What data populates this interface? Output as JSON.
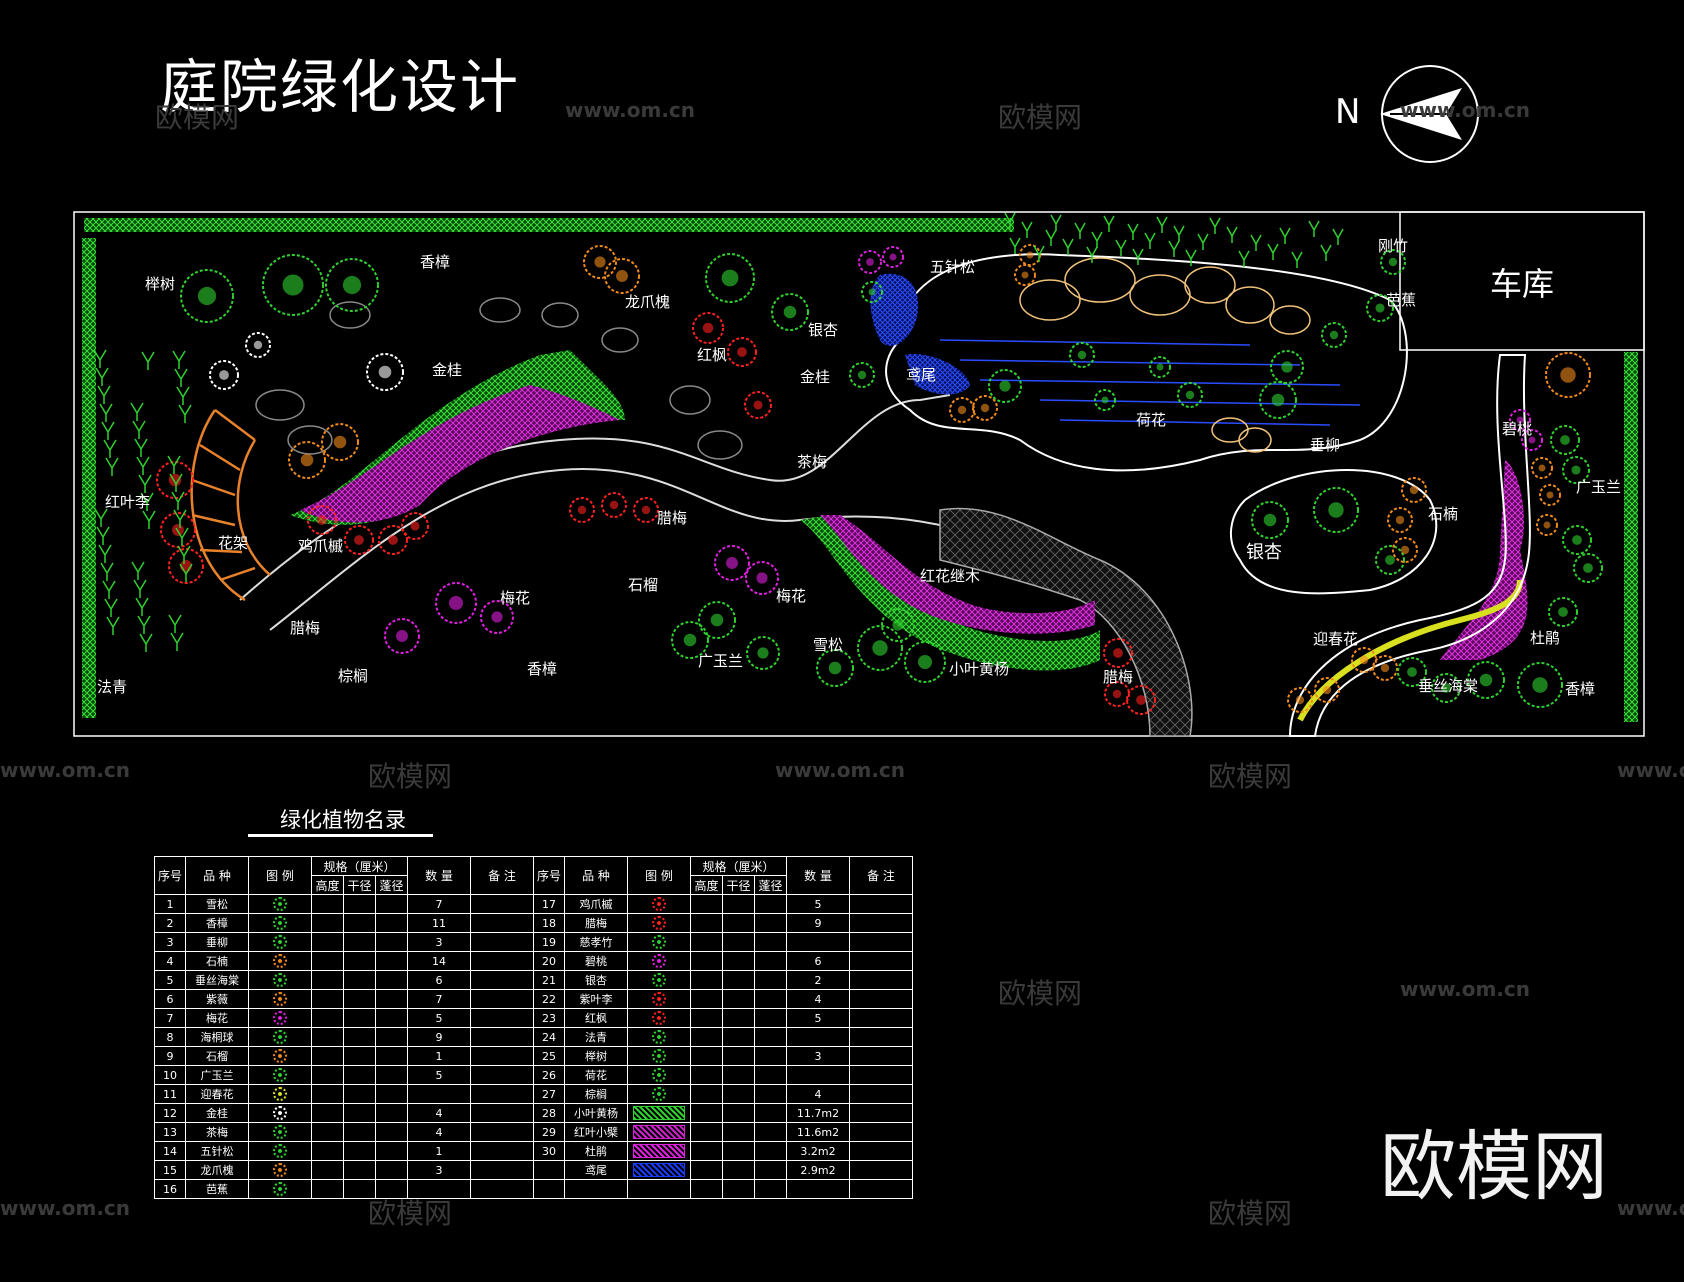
{
  "title": "庭院绿化设计",
  "north_label": "N",
  "garage_label": "车库",
  "brand": "欧模网",
  "watermarks": {
    "cn": "欧模网",
    "url": "www.om.cn"
  },
  "plan_labels": [
    {
      "id": "lbl-ju-shu",
      "text": "榉树"
    },
    {
      "id": "lbl-xiang-zhang-1",
      "text": "香樟"
    },
    {
      "id": "lbl-long-zhao-huai",
      "text": "龙爪槐"
    },
    {
      "id": "lbl-wu-zhen-song",
      "text": "五针松"
    },
    {
      "id": "lbl-gang-zhu",
      "text": "刚竹"
    },
    {
      "id": "lbl-ba-jiao",
      "text": "芭蕉"
    },
    {
      "id": "lbl-jin-gui-1",
      "text": "金桂"
    },
    {
      "id": "lbl-hong-feng",
      "text": "红枫"
    },
    {
      "id": "lbl-yin-xing-1",
      "text": "银杏"
    },
    {
      "id": "lbl-jin-gui-2",
      "text": "金桂"
    },
    {
      "id": "lbl-yuan-wei",
      "text": "鸢尾"
    },
    {
      "id": "lbl-he-hua",
      "text": "荷花"
    },
    {
      "id": "lbl-chui-liu",
      "text": "垂柳"
    },
    {
      "id": "lbl-bi-tao",
      "text": "碧桃"
    },
    {
      "id": "lbl-guang-yu-lan-1",
      "text": "广玉兰"
    },
    {
      "id": "lbl-cha-mei",
      "text": "茶梅"
    },
    {
      "id": "lbl-hong-ye-li",
      "text": "红叶李"
    },
    {
      "id": "lbl-hua-jia",
      "text": "花架"
    },
    {
      "id": "lbl-ji-zhao-qi",
      "text": "鸡爪槭"
    },
    {
      "id": "lbl-la-mei-1",
      "text": "腊梅"
    },
    {
      "id": "lbl-shi-liu",
      "text": "石榴"
    },
    {
      "id": "lbl-mei-hua-1",
      "text": "梅花"
    },
    {
      "id": "lbl-mei-hua-2",
      "text": "梅花"
    },
    {
      "id": "lbl-hong-hua-ji-mu",
      "text": "红花继木"
    },
    {
      "id": "lbl-shi-nan",
      "text": "石楠"
    },
    {
      "id": "lbl-yin-xing-2",
      "text": "银杏"
    },
    {
      "id": "lbl-la-mei-2",
      "text": "腊梅"
    },
    {
      "id": "lbl-xue-song",
      "text": "雪松"
    },
    {
      "id": "lbl-zong-lv",
      "text": "棕榈"
    },
    {
      "id": "lbl-xiang-zhang-2",
      "text": "香樟"
    },
    {
      "id": "lbl-guang-yu-lan-2",
      "text": "广玉兰"
    },
    {
      "id": "lbl-xiao-ye-huang-yang",
      "text": "小叶黄杨"
    },
    {
      "id": "lbl-la-mei-3",
      "text": "腊梅"
    },
    {
      "id": "lbl-fa-qing",
      "text": "法青"
    },
    {
      "id": "lbl-ying-chun-hua",
      "text": "迎春花"
    },
    {
      "id": "lbl-chui-si-hai-tang",
      "text": "垂丝海棠"
    },
    {
      "id": "lbl-du-juan",
      "text": "杜鹃"
    },
    {
      "id": "lbl-xiang-zhang-3",
      "text": "香樟"
    }
  ],
  "legend": {
    "title": "绿化植物名录",
    "headers": {
      "no": "序号",
      "species": "品 种",
      "symbol": "图 例",
      "spec": "规格（厘米）",
      "height": "高度",
      "trunk": "干径",
      "crown": "蓬径",
      "qty": "数 量",
      "remark": "备 注"
    },
    "left_rows": [
      {
        "no": "1",
        "name": "雪松",
        "qty": "7",
        "color": "#2fd12f"
      },
      {
        "no": "2",
        "name": "香樟",
        "qty": "11",
        "color": "#2fd12f"
      },
      {
        "no": "3",
        "name": "垂柳",
        "qty": "3",
        "color": "#2fd12f"
      },
      {
        "no": "4",
        "name": "石楠",
        "qty": "14",
        "color": "#f08a1a"
      },
      {
        "no": "5",
        "name": "垂丝海棠",
        "qty": "6",
        "color": "#2fd12f"
      },
      {
        "no": "6",
        "name": "紫薇",
        "qty": "7",
        "color": "#f08a1a"
      },
      {
        "no": "7",
        "name": "梅花",
        "qty": "5",
        "color": "#e020e0"
      },
      {
        "no": "8",
        "name": "海桐球",
        "qty": "9",
        "color": "#2fd12f"
      },
      {
        "no": "9",
        "name": "石榴",
        "qty": "1",
        "color": "#f08a1a"
      },
      {
        "no": "10",
        "name": "广玉兰",
        "qty": "5",
        "color": "#2fd12f"
      },
      {
        "no": "11",
        "name": "迎春花",
        "qty": "",
        "color": "#d8e020"
      },
      {
        "no": "12",
        "name": "金桂",
        "qty": "4",
        "color": "#ffffff"
      },
      {
        "no": "13",
        "name": "茶梅",
        "qty": "4",
        "color": "#2fd12f"
      },
      {
        "no": "14",
        "name": "五针松",
        "qty": "1",
        "color": "#2fd12f"
      },
      {
        "no": "15",
        "name": "龙爪槐",
        "qty": "3",
        "color": "#f08a1a"
      },
      {
        "no": "16",
        "name": "芭蕉",
        "qty": "",
        "color": "#2fd12f"
      }
    ],
    "right_rows": [
      {
        "no": "17",
        "name": "鸡爪槭",
        "qty": "5",
        "color": "#ff2020",
        "kind": "circ"
      },
      {
        "no": "18",
        "name": "腊梅",
        "qty": "9",
        "color": "#ff2020",
        "kind": "circ"
      },
      {
        "no": "19",
        "name": "慈孝竹",
        "qty": "",
        "color": "#2fd12f",
        "kind": "circ"
      },
      {
        "no": "20",
        "name": "碧桃",
        "qty": "6",
        "color": "#e020e0",
        "kind": "circ"
      },
      {
        "no": "21",
        "name": "银杏",
        "qty": "2",
        "color": "#2fd12f",
        "kind": "circ"
      },
      {
        "no": "22",
        "name": "紫叶李",
        "qty": "4",
        "color": "#ff2020",
        "kind": "circ"
      },
      {
        "no": "23",
        "name": "红枫",
        "qty": "5",
        "color": "#ff2020",
        "kind": "circ"
      },
      {
        "no": "24",
        "name": "法青",
        "qty": "",
        "color": "#2fd12f",
        "kind": "circ"
      },
      {
        "no": "25",
        "name": "榉树",
        "qty": "3",
        "color": "#2fd12f",
        "kind": "circ"
      },
      {
        "no": "26",
        "name": "荷花",
        "qty": "",
        "color": "#2fd12f",
        "kind": "circ"
      },
      {
        "no": "27",
        "name": "棕榈",
        "qty": "4",
        "color": "#2fd12f",
        "kind": "circ"
      },
      {
        "no": "28",
        "name": "小叶黄杨",
        "qty": "11.7m2",
        "color": "#2fd12f",
        "kind": "rect"
      },
      {
        "no": "29",
        "name": "红叶小檗",
        "qty": "11.6m2",
        "color": "#d020d0",
        "kind": "rect"
      },
      {
        "no": "30",
        "name": "杜鹃",
        "qty": "3.2m2",
        "color": "#e020e0",
        "kind": "rect"
      },
      {
        "no": "",
        "name": "鸢尾",
        "qty": "2.9m2",
        "color": "#1a3bff",
        "kind": "rect"
      },
      {
        "no": "",
        "name": "",
        "qty": "",
        "color": "",
        "kind": "none"
      }
    ]
  }
}
